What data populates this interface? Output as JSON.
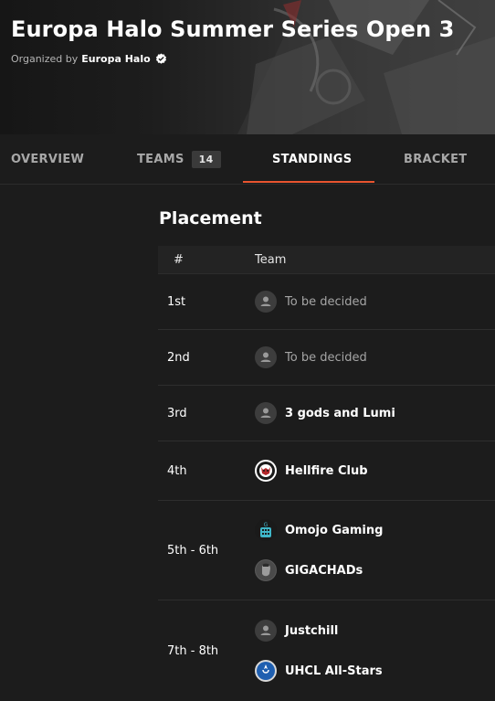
{
  "header": {
    "title": "Europa Halo Summer Series Open 3",
    "organized_by": "Organized by",
    "organizer": "Europa Halo"
  },
  "tabs": [
    {
      "label": "OVERVIEW"
    },
    {
      "label": "TEAMS",
      "count": "14"
    },
    {
      "label": "STANDINGS",
      "active": true
    },
    {
      "label": "BRACKET"
    }
  ],
  "accent_color": "#e8542f",
  "placement": {
    "title": "Placement",
    "col_rank": "#",
    "col_team": "Team",
    "rows": [
      {
        "rank": "1st",
        "teams": [
          {
            "name": "To be decided",
            "logo": "avatar-placeholder-icon"
          }
        ]
      },
      {
        "rank": "2nd",
        "teams": [
          {
            "name": "To be decided",
            "logo": "avatar-placeholder-icon"
          }
        ]
      },
      {
        "rank": "3rd",
        "teams": [
          {
            "name": "3 gods and Lumi",
            "logo": "avatar-placeholder-icon"
          }
        ]
      },
      {
        "rank": "4th",
        "teams": [
          {
            "name": "Hellfire Club",
            "logo": "hellfire-club-logo"
          }
        ]
      },
      {
        "rank": "5th - 6th",
        "teams": [
          {
            "name": "Omojo Gaming",
            "logo": "omojo-gaming-logo"
          },
          {
            "name": "GIGACHADs",
            "logo": "gigachads-logo"
          }
        ]
      },
      {
        "rank": "7th - 8th",
        "teams": [
          {
            "name": "Justchill",
            "logo": "avatar-placeholder-icon"
          },
          {
            "name": "UHCL All-Stars",
            "logo": "uhcl-all-stars-logo"
          }
        ]
      }
    ]
  }
}
